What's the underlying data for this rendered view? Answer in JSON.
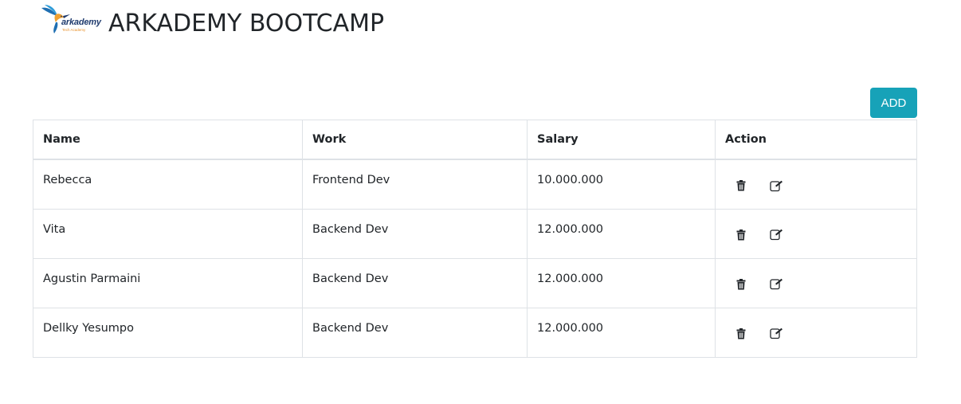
{
  "header": {
    "logo_text": "arkademy",
    "logo_sub": "Tech Academy",
    "title": "ARKADEMY BOOTCAMP"
  },
  "toolbar": {
    "add_label": "ADD"
  },
  "table": {
    "columns": [
      "Name",
      "Work",
      "Salary",
      "Action"
    ],
    "rows": [
      {
        "name": "Rebecca",
        "work": "Frontend Dev",
        "salary": "10.000.000"
      },
      {
        "name": "Vita",
        "work": "Backend Dev",
        "salary": "12.000.000"
      },
      {
        "name": "Agustin Parmaini",
        "work": "Backend Dev",
        "salary": "12.000.000"
      },
      {
        "name": "Dellky Yesumpo",
        "work": "Backend Dev",
        "salary": "12.000.000"
      }
    ]
  },
  "icons": {
    "delete": "trash-icon",
    "edit": "edit-icon"
  },
  "colors": {
    "accent": "#17a2b8",
    "border": "#dee2e6",
    "text": "#212529"
  }
}
